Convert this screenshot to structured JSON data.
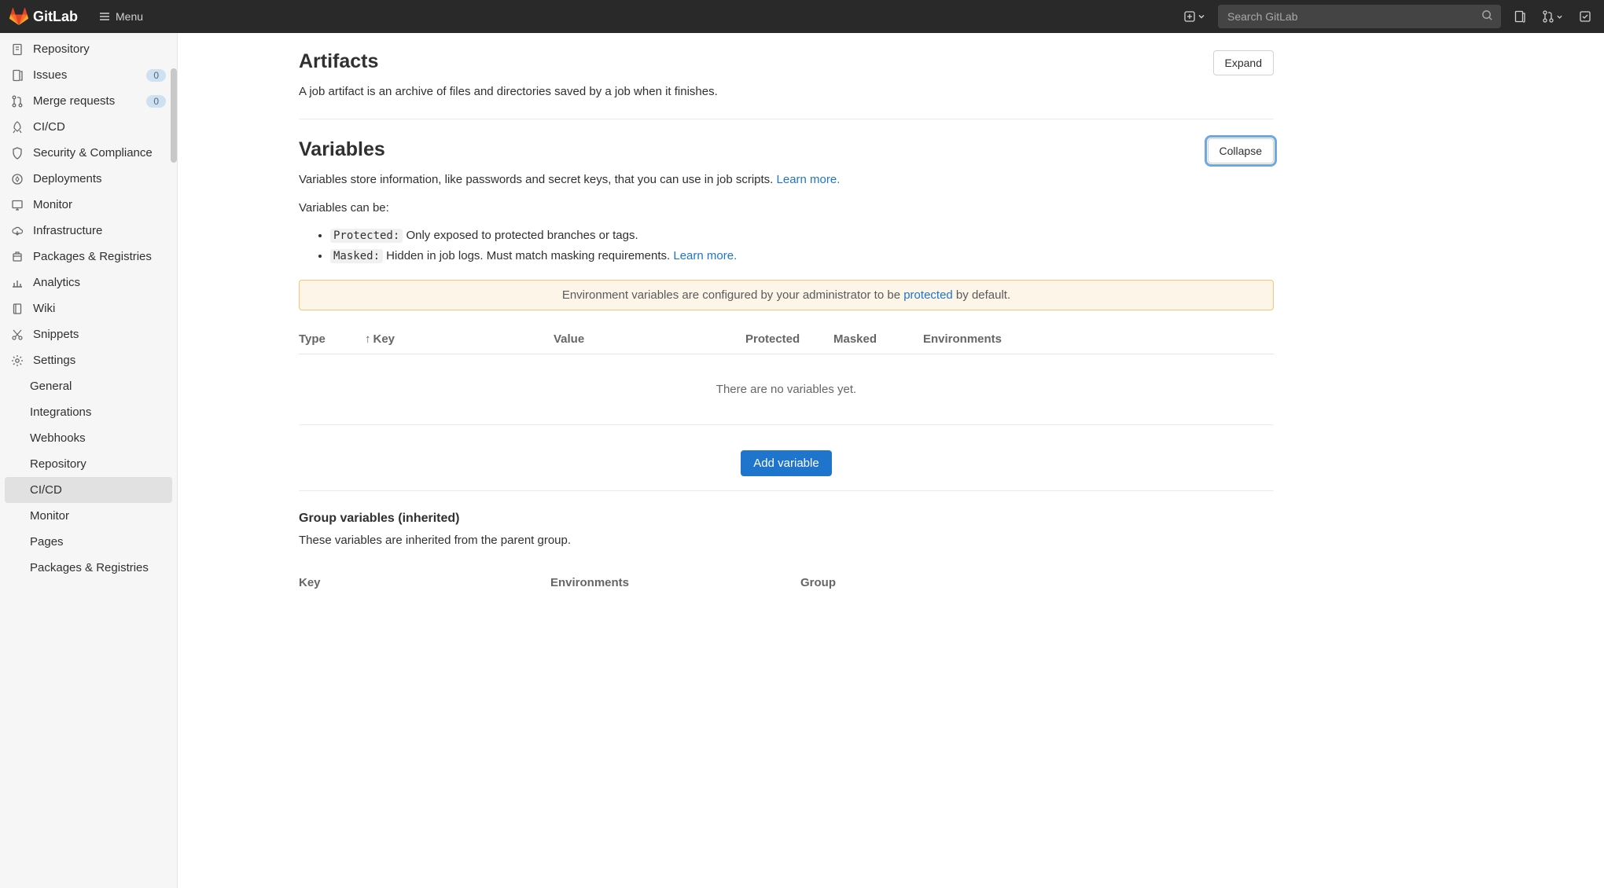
{
  "topbar": {
    "brand": "GitLab",
    "menu_label": "Menu",
    "search_placeholder": "Search GitLab"
  },
  "sidebar": {
    "items": [
      {
        "label": "Repository",
        "icon": "doc"
      },
      {
        "label": "Issues",
        "icon": "issue",
        "badge": "0"
      },
      {
        "label": "Merge requests",
        "icon": "mr",
        "badge": "0"
      },
      {
        "label": "CI/CD",
        "icon": "rocket"
      },
      {
        "label": "Security & Compliance",
        "icon": "shield"
      },
      {
        "label": "Deployments",
        "icon": "deploy"
      },
      {
        "label": "Monitor",
        "icon": "monitor"
      },
      {
        "label": "Infrastructure",
        "icon": "cloud"
      },
      {
        "label": "Packages & Registries",
        "icon": "package"
      },
      {
        "label": "Analytics",
        "icon": "chart"
      },
      {
        "label": "Wiki",
        "icon": "book"
      },
      {
        "label": "Snippets",
        "icon": "scissors"
      },
      {
        "label": "Settings",
        "icon": "gear"
      }
    ],
    "sub": [
      {
        "label": "General"
      },
      {
        "label": "Integrations"
      },
      {
        "label": "Webhooks"
      },
      {
        "label": "Repository"
      },
      {
        "label": "CI/CD",
        "active": true
      },
      {
        "label": "Monitor"
      },
      {
        "label": "Pages"
      },
      {
        "label": "Packages & Registries"
      }
    ]
  },
  "artifacts": {
    "title": "Artifacts",
    "toggle": "Expand",
    "desc": "A job artifact is an archive of files and directories saved by a job when it finishes."
  },
  "variables": {
    "title": "Variables",
    "toggle": "Collapse",
    "desc_prefix": "Variables store information, like passwords and secret keys, that you can use in job scripts. ",
    "learn_more": "Learn more.",
    "can_be": "Variables can be:",
    "protected_code": "Protected:",
    "protected_text": " Only exposed to protected branches or tags.",
    "masked_code": "Masked:",
    "masked_text": " Hidden in job logs. Must match masking requirements. ",
    "notice_prefix": "Environment variables are configured by your administrator to be ",
    "notice_link": "protected",
    "notice_suffix": " by default.",
    "cols": {
      "type": "Type",
      "key": "Key",
      "value": "Value",
      "protected": "Protected",
      "masked": "Masked",
      "environments": "Environments"
    },
    "empty": "There are no variables yet.",
    "add_btn": "Add variable",
    "group_title": "Group variables (inherited)",
    "group_desc": "These variables are inherited from the parent group.",
    "grp_cols": {
      "key": "Key",
      "env": "Environments",
      "group": "Group"
    }
  }
}
